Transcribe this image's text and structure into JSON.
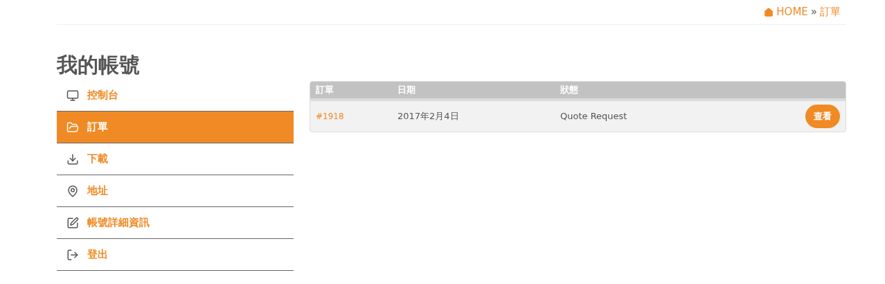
{
  "breadcrumb": {
    "home": "HOME",
    "separator": "»",
    "current": "訂單"
  },
  "title": "我的帳號",
  "sidebar": {
    "items": [
      {
        "kind": "dashboard",
        "label": "控制台",
        "selected": false
      },
      {
        "kind": "orders",
        "label": "訂單",
        "selected": true
      },
      {
        "kind": "downloads",
        "label": "下載",
        "selected": false
      },
      {
        "kind": "address",
        "label": "地址",
        "selected": false
      },
      {
        "kind": "account",
        "label": "帳號詳細資訊",
        "selected": false
      },
      {
        "kind": "logout",
        "label": "登出",
        "selected": false
      }
    ]
  },
  "table": {
    "columns": [
      "訂單",
      "日期",
      "狀態"
    ],
    "rows": [
      {
        "order": "#1918",
        "date": "2017年2月4日",
        "status": "Quote Request",
        "action": "查看"
      }
    ]
  }
}
